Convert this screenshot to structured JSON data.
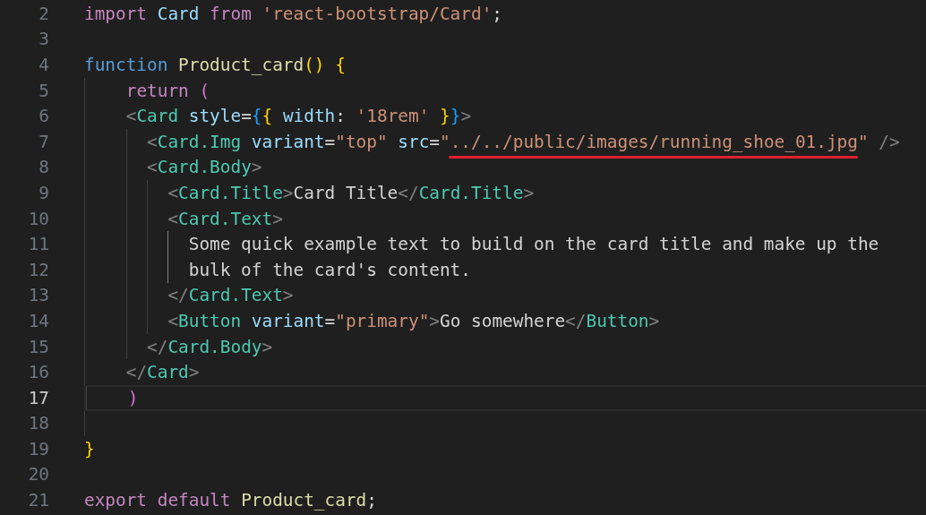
{
  "editor": {
    "lines": [
      {
        "number": "2",
        "current": false,
        "tokens": [
          {
            "text": "import ",
            "kind": "keyword"
          },
          {
            "text": "Card ",
            "kind": "variable"
          },
          {
            "text": "from ",
            "kind": "keyword"
          },
          {
            "text": "'react-bootstrap/Card'",
            "kind": "string"
          },
          {
            "text": ";",
            "kind": "plain"
          }
        ]
      },
      {
        "number": "3",
        "current": false
      },
      {
        "number": "4",
        "current": false,
        "tokens": [
          {
            "text": "function ",
            "kind": "storage"
          },
          {
            "text": "Product_card",
            "kind": "function"
          },
          {
            "text": "() {",
            "kind": "bracket1"
          }
        ]
      },
      {
        "number": "5",
        "current": false,
        "active_guide": false,
        "tokens": [
          {
            "text": "    return ",
            "kind": "keyword"
          },
          {
            "text": "(",
            "kind": "bracket2"
          }
        ]
      },
      {
        "number": "6",
        "current": false,
        "active_guide": false,
        "tokens": [
          {
            "text": "    <",
            "kind": "punct"
          },
          {
            "text": "Card ",
            "kind": "tag"
          },
          {
            "text": "style",
            "kind": "attr"
          },
          {
            "text": "=",
            "kind": "plain"
          },
          {
            "text": "{",
            "kind": "bracket3"
          },
          {
            "text": "{ ",
            "kind": "bracket1"
          },
          {
            "text": "width",
            "kind": "attr"
          },
          {
            "text": ": ",
            "kind": "plain"
          },
          {
            "text": "'18rem' ",
            "kind": "string"
          },
          {
            "text": "}",
            "kind": "bracket1"
          },
          {
            "text": "}",
            "kind": "bracket3"
          },
          {
            "text": ">",
            "kind": "punct"
          }
        ]
      },
      {
        "number": "7",
        "current": false,
        "active_guide": false,
        "tokens": [
          {
            "text": "      <",
            "kind": "punct"
          },
          {
            "text": "Card.Img ",
            "kind": "tag"
          },
          {
            "text": "variant",
            "kind": "attr"
          },
          {
            "text": "=",
            "kind": "plain"
          },
          {
            "text": "\"top\" ",
            "kind": "string"
          },
          {
            "text": "src",
            "kind": "attr"
          },
          {
            "text": "=",
            "kind": "plain"
          },
          {
            "text": "\"../../public/images/running_shoe_01.jpg\"",
            "kind": "string",
            "underlined": true
          },
          {
            "text": " />",
            "kind": "punct"
          }
        ]
      },
      {
        "number": "8",
        "current": false,
        "active_guide": false,
        "tokens": [
          {
            "text": "      <",
            "kind": "punct"
          },
          {
            "text": "Card.Body",
            "kind": "tag"
          },
          {
            "text": ">",
            "kind": "punct"
          }
        ]
      },
      {
        "number": "9",
        "current": false,
        "active_guide": false,
        "tokens": [
          {
            "text": "        <",
            "kind": "punct"
          },
          {
            "text": "Card.Title",
            "kind": "tag"
          },
          {
            "text": ">",
            "kind": "punct"
          },
          {
            "text": "Card Title",
            "kind": "plain"
          },
          {
            "text": "</",
            "kind": "punct"
          },
          {
            "text": "Card.Title",
            "kind": "tag"
          },
          {
            "text": ">",
            "kind": "punct"
          }
        ]
      },
      {
        "number": "10",
        "current": false,
        "active_guide": false,
        "tokens": [
          {
            "text": "        <",
            "kind": "punct"
          },
          {
            "text": "Card.Text",
            "kind": "tag"
          },
          {
            "text": ">",
            "kind": "punct"
          }
        ]
      },
      {
        "number": "11",
        "current": false,
        "active_guide": true,
        "tokens": [
          {
            "text": "          Some quick example text to build on the card title and make up the",
            "kind": "plain"
          }
        ]
      },
      {
        "number": "12",
        "current": false,
        "active_guide": true,
        "tokens": [
          {
            "text": "          bulk of the card's content.",
            "kind": "plain"
          }
        ]
      },
      {
        "number": "13",
        "current": false,
        "active_guide": false,
        "tokens": [
          {
            "text": "        </",
            "kind": "punct"
          },
          {
            "text": "Card.Text",
            "kind": "tag"
          },
          {
            "text": ">",
            "kind": "punct"
          }
        ]
      },
      {
        "number": "14",
        "current": false,
        "active_guide": false,
        "tokens": [
          {
            "text": "        <",
            "kind": "punct"
          },
          {
            "text": "Button ",
            "kind": "tag"
          },
          {
            "text": "variant",
            "kind": "attr"
          },
          {
            "text": "=",
            "kind": "plain"
          },
          {
            "text": "\"primary\"",
            "kind": "string"
          },
          {
            "text": ">",
            "kind": "punct"
          },
          {
            "text": "Go somewhere",
            "kind": "plain"
          },
          {
            "text": "</",
            "kind": "punct"
          },
          {
            "text": "Button",
            "kind": "tag"
          },
          {
            "text": ">",
            "kind": "punct"
          }
        ]
      },
      {
        "number": "15",
        "current": false,
        "active_guide": false,
        "tokens": [
          {
            "text": "      </",
            "kind": "punct"
          },
          {
            "text": "Card.Body",
            "kind": "tag"
          },
          {
            "text": ">",
            "kind": "punct"
          }
        ]
      },
      {
        "number": "16",
        "current": false,
        "active_guide": false,
        "tokens": [
          {
            "text": "    </",
            "kind": "punct"
          },
          {
            "text": "Card",
            "kind": "tag"
          },
          {
            "text": ">",
            "kind": "punct"
          }
        ]
      },
      {
        "number": "17",
        "current": true,
        "active_guide": false,
        "tokens": [
          {
            "text": "    )",
            "kind": "bracket2"
          }
        ]
      },
      {
        "number": "18",
        "current": false,
        "active_guide": false
      },
      {
        "number": "19",
        "current": false,
        "tokens": [
          {
            "text": "}",
            "kind": "bracket1"
          }
        ]
      },
      {
        "number": "20",
        "current": false
      },
      {
        "number": "21",
        "current": false,
        "tokens": [
          {
            "text": "export ",
            "kind": "keyword"
          },
          {
            "text": "default ",
            "kind": "keyword"
          },
          {
            "text": "Product_card",
            "kind": "function"
          },
          {
            "text": ";",
            "kind": "plain"
          }
        ]
      }
    ]
  }
}
